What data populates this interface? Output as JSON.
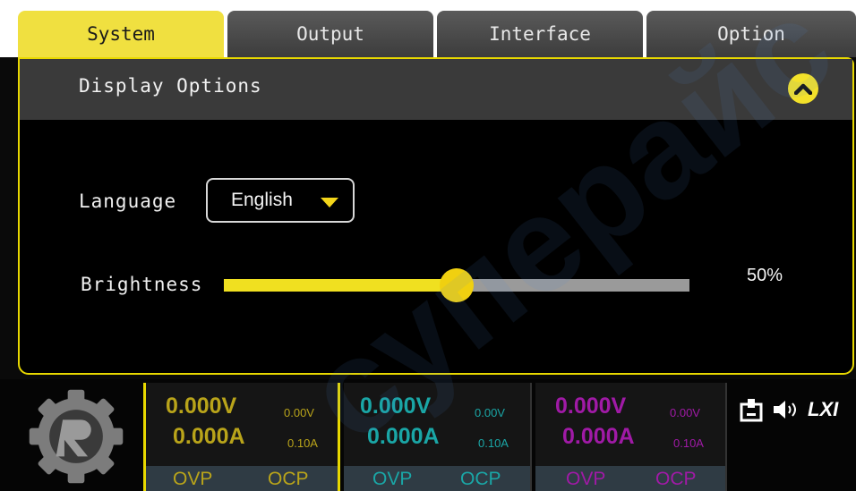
{
  "tabs": [
    {
      "label": "System",
      "active": true
    },
    {
      "label": "Output",
      "active": false
    },
    {
      "label": "Interface",
      "active": false
    },
    {
      "label": "Option",
      "active": false
    }
  ],
  "panel": {
    "title": "Display Options",
    "collapse_icon": "chevron-up-circle-icon"
  },
  "language": {
    "label": "Language",
    "value": "English"
  },
  "brightness": {
    "label": "Brightness",
    "value_text": "50%",
    "level_percent": 50
  },
  "channels": [
    {
      "voltage": "0.000V",
      "current": "0.000A",
      "set_voltage": "0.00V",
      "set_current": "0.10A",
      "ovp": "OVP",
      "ocp": "OCP",
      "color": "#b9a41a"
    },
    {
      "voltage": "0.000V",
      "current": "0.000A",
      "set_voltage": "0.00V",
      "set_current": "0.10A",
      "ovp": "OVP",
      "ocp": "OCP",
      "color": "#1aa6a6"
    },
    {
      "voltage": "0.000V",
      "current": "0.000A",
      "set_voltage": "0.00V",
      "set_current": "0.10A",
      "ovp": "OVP",
      "ocp": "OCP",
      "color": "#a01aa6"
    }
  ],
  "status_icons": {
    "usb": "usb-icon",
    "sound": "speaker-icon",
    "lxi": "LXI"
  },
  "colors": {
    "accent": "#f0e040",
    "panel_header": "#3a3a3a",
    "slider_track": "#9a9a9a"
  },
  "watermark": "суперайс"
}
